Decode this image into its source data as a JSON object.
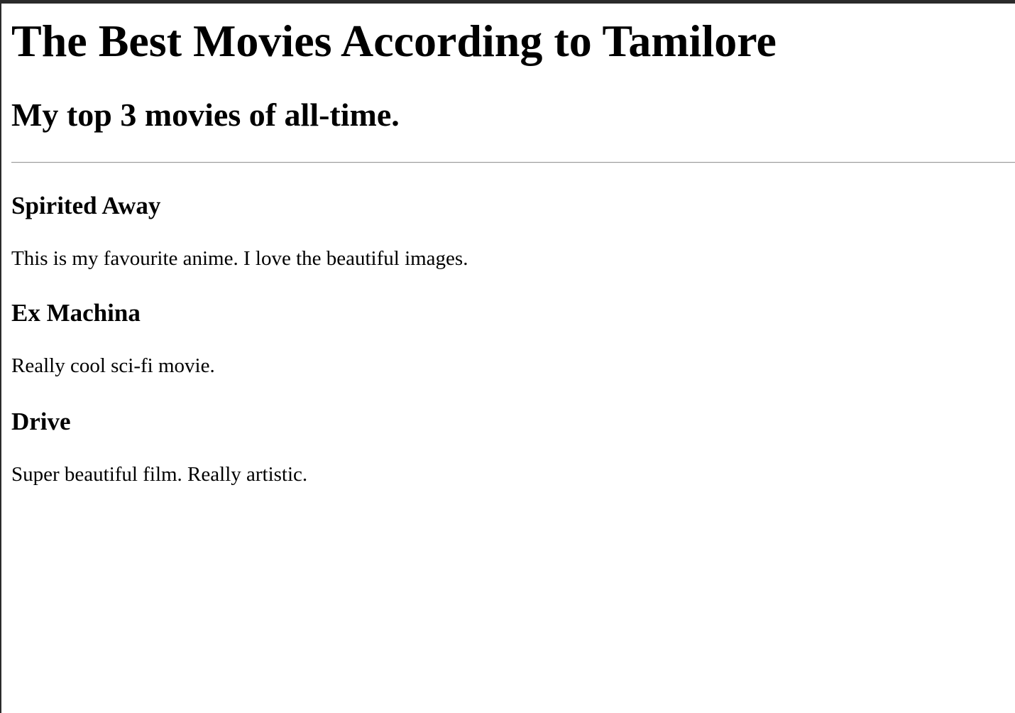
{
  "page": {
    "title": "The Best Movies According to Tamilore",
    "subtitle": "My top 3 movies of all-time."
  },
  "movies": [
    {
      "title": "Spirited Away",
      "description": "This is my favourite anime. I love the beautiful images."
    },
    {
      "title": "Ex Machina",
      "description": "Really cool sci-fi movie."
    },
    {
      "title": "Drive",
      "description": "Super beautiful film. Really artistic."
    }
  ]
}
